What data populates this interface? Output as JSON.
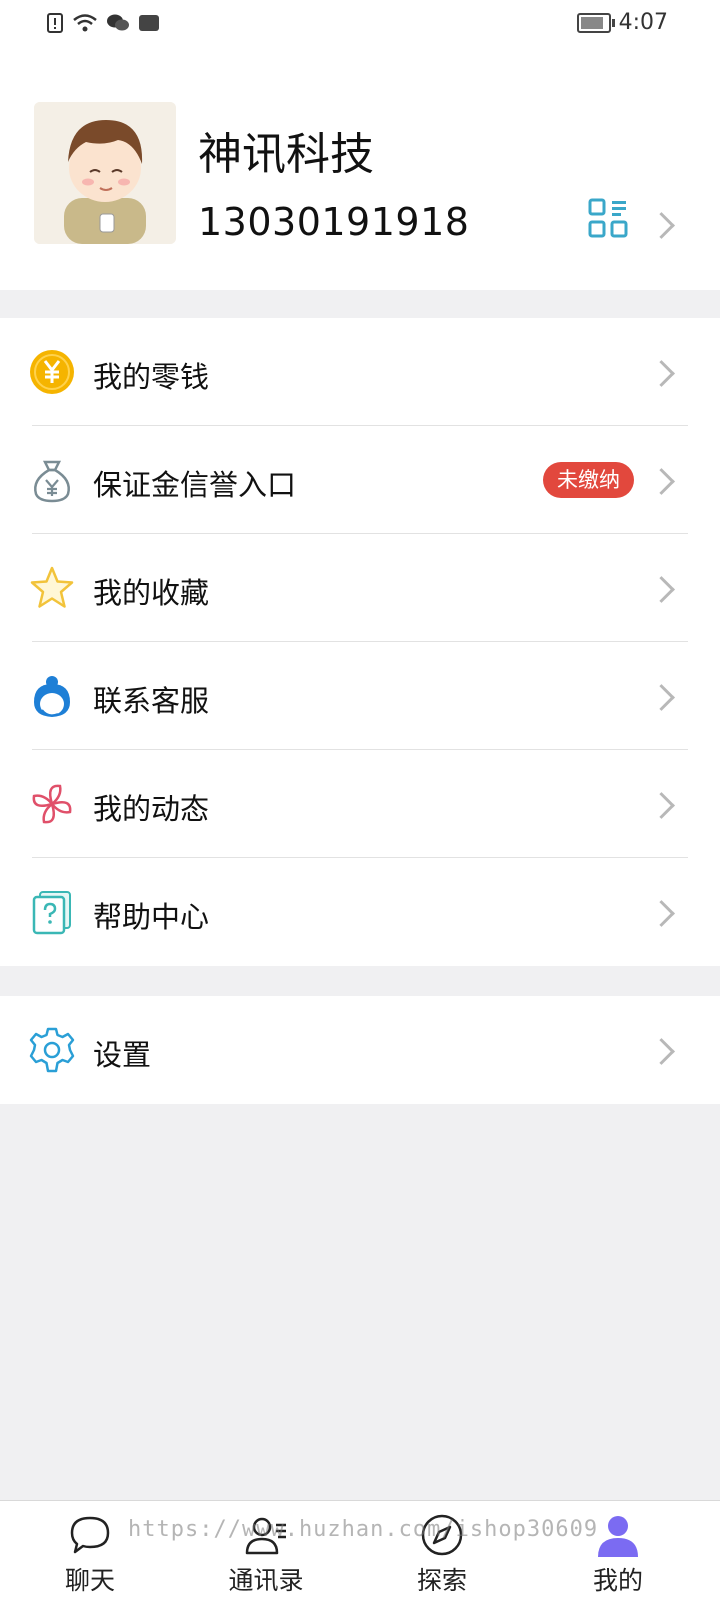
{
  "status_bar": {
    "time": "4:07"
  },
  "profile": {
    "name": "神讯科技",
    "phone": "13030191918",
    "avatar_icon": "cartoon-boy-avatar",
    "qr_icon": "qr-code-icon"
  },
  "menu": {
    "items": [
      {
        "label": "我的零钱",
        "icon": "wallet-yen-icon",
        "color": "#f5b400"
      },
      {
        "label": "保证金信誉入口",
        "icon": "money-bag-icon",
        "badge": "未缴纳",
        "color": "#7a8c94"
      },
      {
        "label": "我的收藏",
        "icon": "star-icon",
        "color": "#f2c33a"
      },
      {
        "label": "联系客服",
        "icon": "customer-service-icon",
        "color": "#1e7fd6"
      },
      {
        "label": "我的动态",
        "icon": "pinwheel-icon",
        "color": "#e0506a"
      },
      {
        "label": "帮助中心",
        "icon": "help-doc-icon",
        "color": "#3ab7b5"
      }
    ],
    "settings": {
      "label": "设置",
      "icon": "gear-icon",
      "color": "#2a9fd6"
    }
  },
  "tabbar": {
    "tabs": [
      {
        "label": "聊天",
        "icon": "chat-bubble-icon"
      },
      {
        "label": "通讯录",
        "icon": "contacts-icon"
      },
      {
        "label": "探索",
        "icon": "compass-icon"
      },
      {
        "label": "我的",
        "icon": "person-icon",
        "active": true,
        "color": "#7b6bf2"
      }
    ]
  },
  "watermark": "https://www.huzhan.com/ishop30609"
}
